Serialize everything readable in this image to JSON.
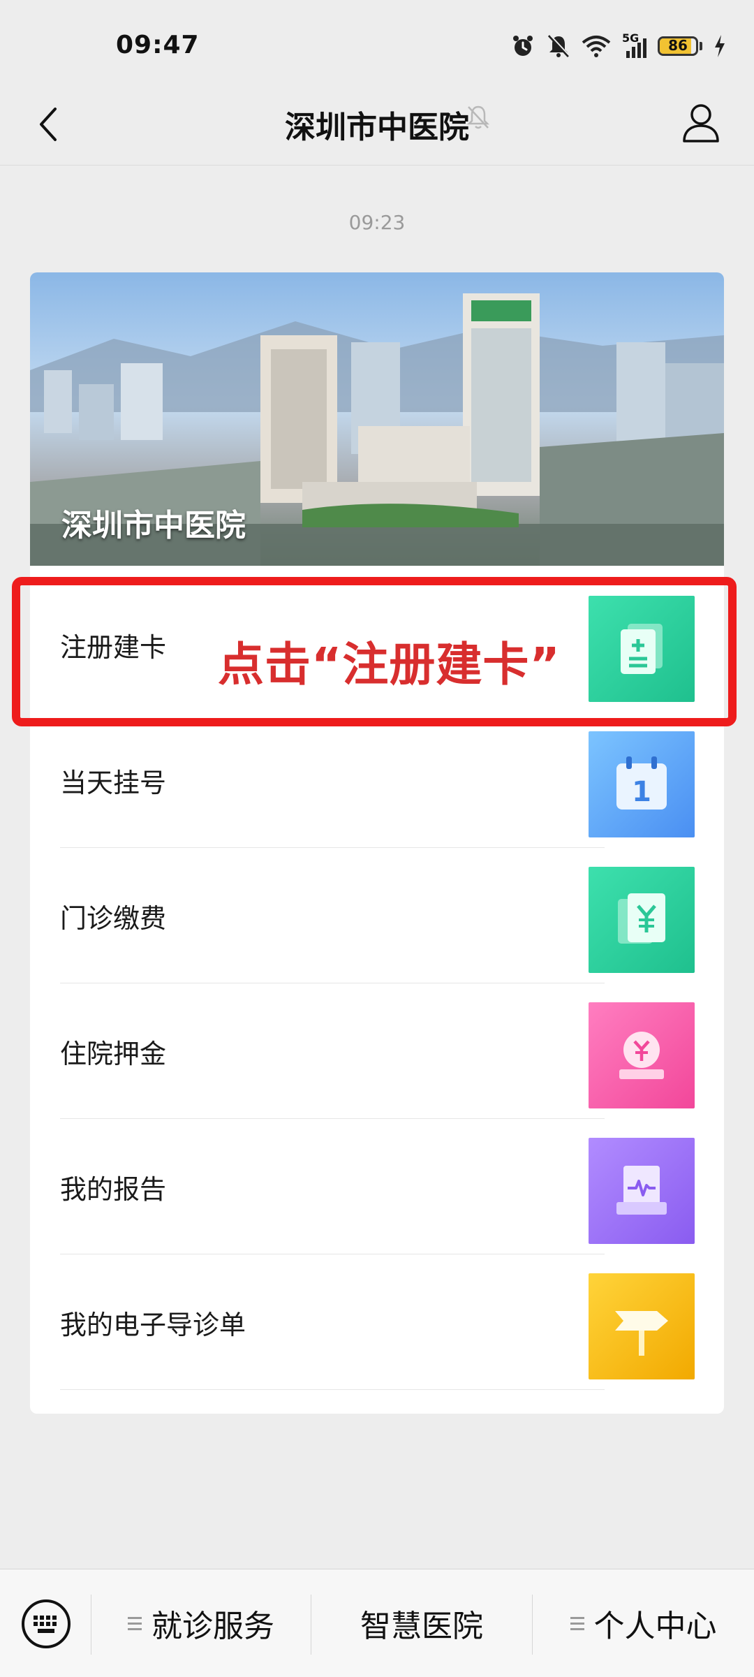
{
  "status_bar": {
    "time": "09:47",
    "battery": "86",
    "battery_level": 0.86,
    "network": "5G"
  },
  "nav": {
    "title": "深圳市中医院"
  },
  "message": {
    "time": "09:23"
  },
  "banner": {
    "title": "深圳市中医院"
  },
  "menu": [
    {
      "label": "注册建卡",
      "icon": "register-card-icon",
      "color": "#2ed3a0"
    },
    {
      "label": "当天挂号",
      "icon": "calendar-icon",
      "color": "#5aa8f7"
    },
    {
      "label": "门诊缴费",
      "icon": "payment-icon",
      "color": "#2ed3a0"
    },
    {
      "label": "住院押金",
      "icon": "deposit-icon",
      "color": "#f85ea8"
    },
    {
      "label": "我的报告",
      "icon": "report-icon",
      "color": "#9a6df5"
    },
    {
      "label": "我的电子导诊单",
      "icon": "signpost-icon",
      "color": "#f5c518"
    }
  ],
  "annotation": {
    "text": "点击“注册建卡”"
  },
  "bottom_bar": {
    "items": [
      "就诊服务",
      "智慧医院",
      "个人中心"
    ]
  }
}
